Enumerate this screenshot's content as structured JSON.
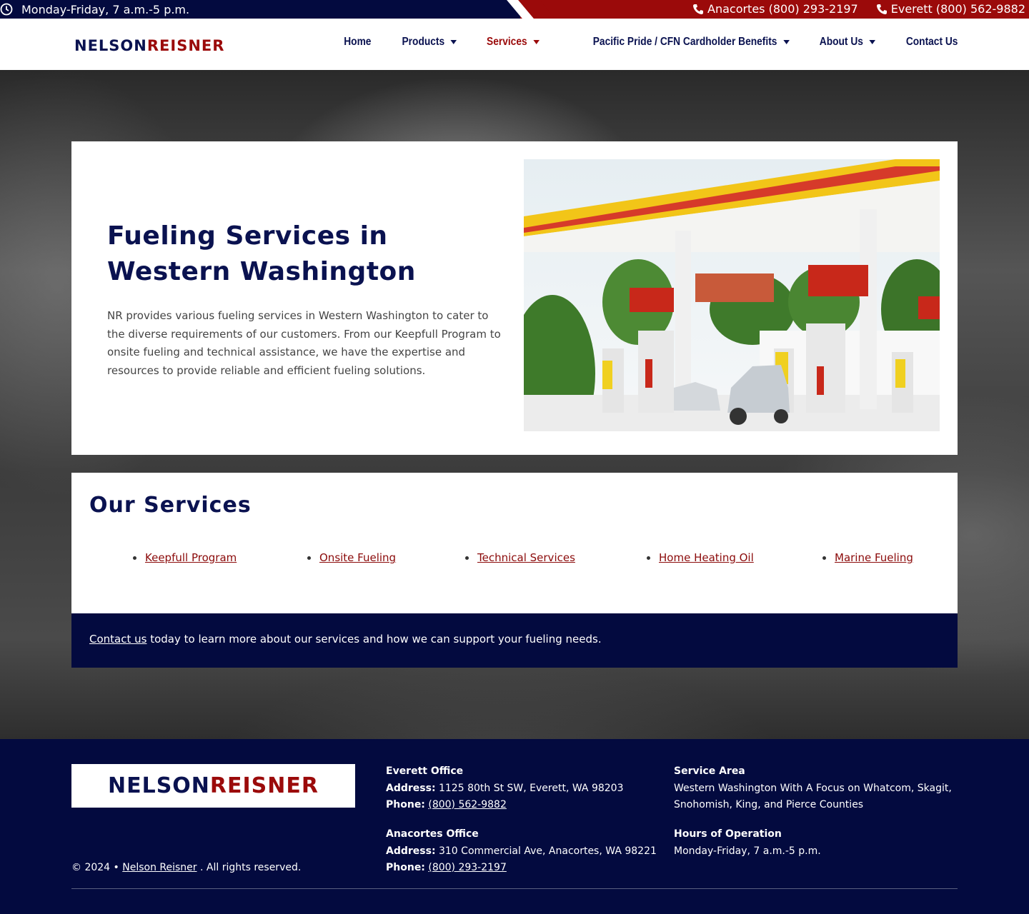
{
  "topbar": {
    "hours": "Monday-Friday, 7 a.m.-5 p.m.",
    "phones": [
      {
        "label": "Anacortes (800) 293-2197"
      },
      {
        "label": "Everett (800) 562-9882"
      }
    ]
  },
  "brand": {
    "part1": "NELSON",
    "part2": "REISNER"
  },
  "nav": {
    "items": [
      {
        "label": "Home",
        "dropdown": false,
        "active": false
      },
      {
        "label": "Products",
        "dropdown": true,
        "active": false
      },
      {
        "label": "Services",
        "dropdown": true,
        "active": true
      },
      {
        "label": "Pacific Pride / CFN Cardholder Benefits",
        "dropdown": true,
        "active": false
      },
      {
        "label": "About Us",
        "dropdown": true,
        "active": false
      },
      {
        "label": "Contact Us",
        "dropdown": false,
        "active": false
      }
    ]
  },
  "hero": {
    "title": "Fueling Services in Western Washington",
    "body": "NR provides various fueling services in Western Washington to cater to the diverse requirements of our customers. From our Keepfull Program to onsite fueling and technical assistance, we have the expertise and resources to provide reliable and efficient fueling solutions."
  },
  "services": {
    "title": "Our Services",
    "items": [
      "Keepfull Program",
      "Onsite Fueling",
      "Technical Services",
      "Home Heating Oil",
      "Marine Fueling"
    ]
  },
  "cta": {
    "link": "Contact us",
    "text": " today to learn more about our services and how we can support your fueling needs."
  },
  "footer": {
    "copyright_prefix": "© 2024 • ",
    "copyright_link": "Nelson Reisner",
    "copyright_suffix": " . All rights reserved.",
    "everett": {
      "heading": "Everett Office",
      "address_label": "Address:",
      "address": " 1125 80th St SW, Everett, WA 98203",
      "phone_label": "Phone:",
      "phone": "(800) 562-9882"
    },
    "anacortes": {
      "heading": "Anacortes Office",
      "address_label": "Address:",
      "address": " 310 Commercial Ave, Anacortes, WA 98221",
      "phone_label": "Phone:",
      "phone": "(800) 293-2197"
    },
    "service_area": {
      "heading": "Service Area",
      "text": "Western Washington With A Focus on Whatcom, Skagit, Snohomish, King, and Pierce Counties"
    },
    "hours": {
      "heading": "Hours of Operation",
      "text": "Monday-Friday, 7 a.m.-5 p.m."
    }
  },
  "colors": {
    "navy": "#030a3f",
    "brand_red": "#9b0a0a",
    "link_red": "#8b0a0a"
  },
  "icons": [
    "clock-icon",
    "phone-icon",
    "chevron-down-icon"
  ]
}
